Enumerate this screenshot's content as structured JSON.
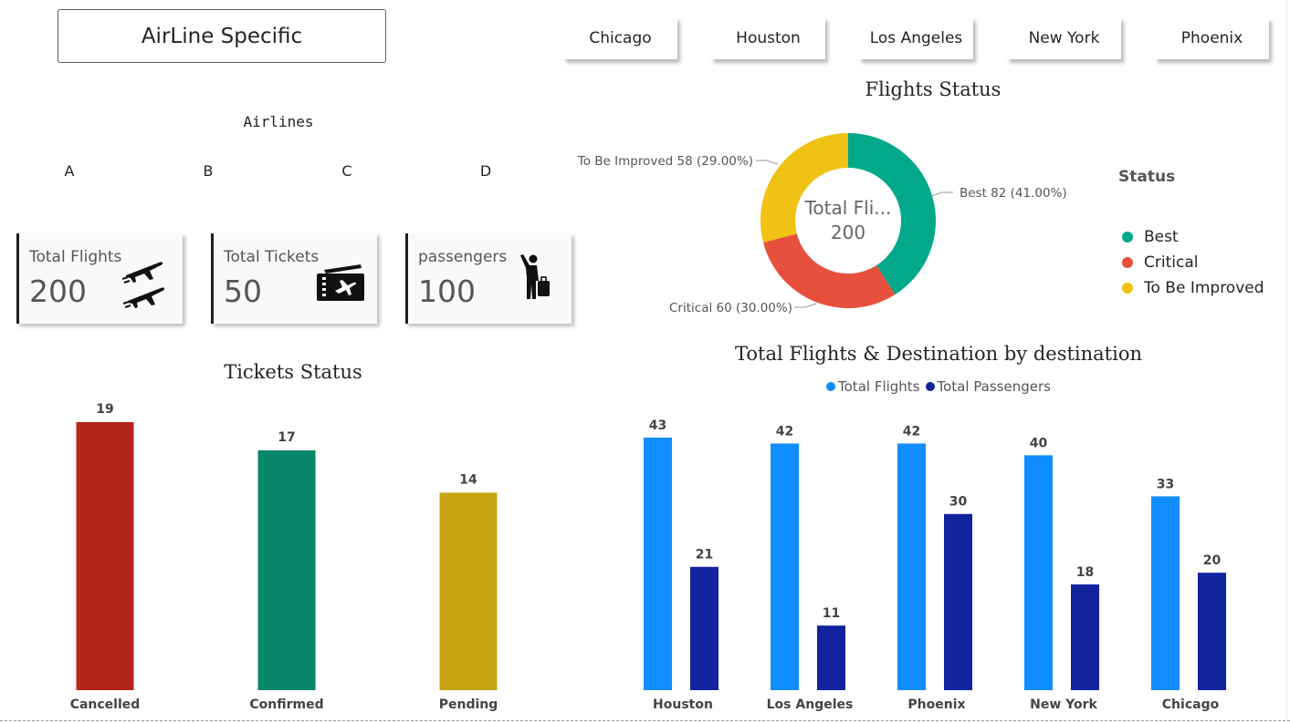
{
  "header": {
    "title": "AirLine Specific",
    "cities": [
      "Chicago",
      "Houston",
      "Los Angeles",
      "New York",
      "Phoenix"
    ]
  },
  "airlines": {
    "label": "Airlines",
    "options": [
      "A",
      "B",
      "C",
      "D"
    ]
  },
  "cards": [
    {
      "label": "Total Flights",
      "value": "200",
      "icon": "planes-icon"
    },
    {
      "label": "Total Tickets",
      "value": "50",
      "icon": "ticket-icon"
    },
    {
      "label": "passengers",
      "value": "100",
      "icon": "traveler-icon"
    }
  ],
  "colors": {
    "best": "#01A88A",
    "critical": "#E8503E",
    "improve": "#F0C214",
    "cancelled": "#B5261A",
    "confirmed": "#08876B",
    "pending": "#C7A414",
    "flights": "#118DFF",
    "passengers": "#12239E"
  },
  "chart_data": [
    {
      "type": "pie",
      "title": "Flights Status",
      "center_label": "Total Fli...",
      "center_value": "200",
      "legend_title": "Status",
      "legend_position": "right",
      "slices": [
        {
          "label": "Best",
          "value": 82,
          "percent": "41.00%",
          "callout": "Best 82 (41.00%)"
        },
        {
          "label": "Critical",
          "value": 60,
          "percent": "30.00%",
          "callout": "Critical 60 (30.00%)"
        },
        {
          "label": "To Be Improved",
          "value": 58,
          "percent": "29.00%",
          "callout": "To Be Improved 58 (29.00%)"
        }
      ]
    },
    {
      "type": "bar",
      "title": "Tickets Status",
      "categories": [
        "Cancelled",
        "Confirmed",
        "Pending"
      ],
      "values": [
        19,
        17,
        14
      ],
      "ylim": [
        0,
        19
      ]
    },
    {
      "type": "bar",
      "title": "Total Flights & Destination by destination",
      "categories": [
        "Houston",
        "Los Angeles",
        "Phoenix",
        "New York",
        "Chicago"
      ],
      "series": [
        {
          "name": "Total Flights",
          "values": [
            43,
            42,
            42,
            40,
            33
          ]
        },
        {
          "name": "Total Passengers",
          "values": [
            21,
            11,
            30,
            18,
            20
          ]
        }
      ],
      "legend_position": "top",
      "ylim": [
        0,
        43
      ]
    }
  ]
}
